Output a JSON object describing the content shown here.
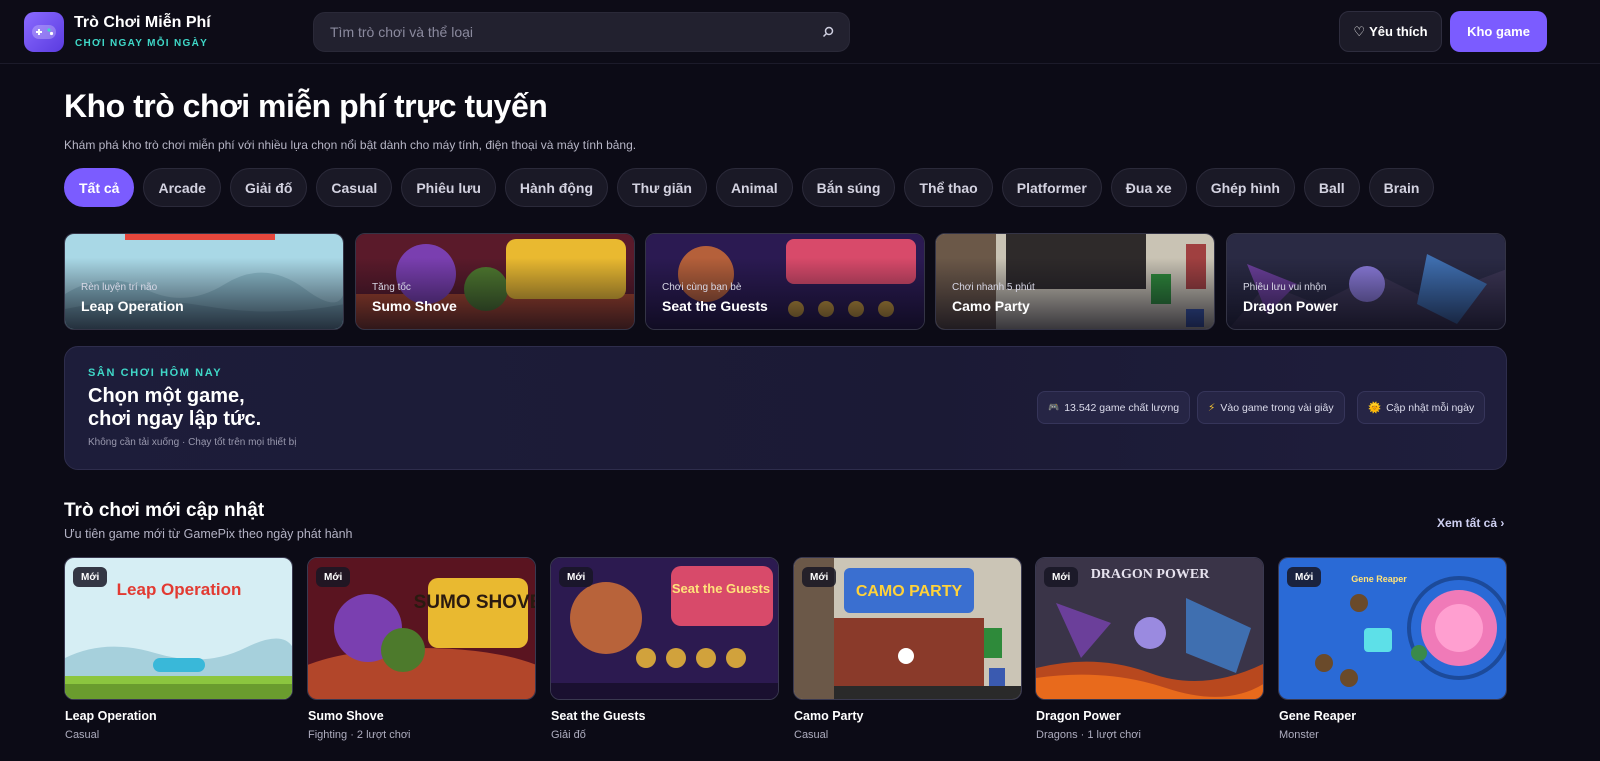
{
  "header": {
    "logo_title": "Trò Chơi Miễn Phí",
    "logo_subtitle": "CHƠI NGAY MỖI NGÀY",
    "search_placeholder": "Tìm trò chơi và thể loại",
    "favorites_label": "Yêu thích",
    "library_label": "Kho game"
  },
  "hero": {
    "title": "Kho trò chơi miễn phí trực tuyến",
    "description": "Khám phá kho trò chơi miễn phí với nhiều lựa chọn nổi bật dành cho máy tính, điện thoại và máy tính bảng."
  },
  "categories": [
    "Tất cả",
    "Arcade",
    "Giải đố",
    "Casual",
    "Phiêu lưu",
    "Hành động",
    "Thư giãn",
    "Animal",
    "Bắn súng",
    "Thể thao",
    "Platformer",
    "Đua xe",
    "Ghép hình",
    "Ball",
    "Brain"
  ],
  "featured": [
    {
      "tag": "Rèn luyện trí não",
      "name": "Leap Operation"
    },
    {
      "tag": "Tăng tốc",
      "name": "Sumo Shove"
    },
    {
      "tag": "Chơi cùng bạn bè",
      "name": "Seat the Guests"
    },
    {
      "tag": "Chơi nhanh 5 phút",
      "name": "Camo Party"
    },
    {
      "tag": "Phiêu lưu vui nhộn",
      "name": "Dragon Power"
    }
  ],
  "today": {
    "eyebrow": "SÂN CHƠI HÔM NAY",
    "headline_1": "Chọn một game,",
    "headline_2": "chơi ngay lập tức.",
    "note": "Không cần tải xuống · Chạy tốt trên mọi thiết bị",
    "stats": [
      {
        "icon": "🎮",
        "text": "13.542 game chất lượng"
      },
      {
        "icon": "⚡",
        "text": "Vào game trong vài giây"
      },
      {
        "icon": "🌞",
        "text": "Cập nhật mỗi ngày"
      }
    ]
  },
  "new_games": {
    "title": "Trò chơi mới cập nhật",
    "subtitle": "Ưu tiên game mới từ GamePix theo ngày phát hành",
    "see_all": "Xem tất cả",
    "badge": "Mới",
    "items": [
      {
        "name": "Leap Operation",
        "meta": "Casual",
        "art_text": "Leap Operation"
      },
      {
        "name": "Sumo Shove",
        "meta": "Fighting · 2 lượt chơi",
        "art_text": "SUMO SHOVE"
      },
      {
        "name": "Seat the Guests",
        "meta": "Giải đố",
        "art_text": "Seat the Guests"
      },
      {
        "name": "Camo Party",
        "meta": "Casual",
        "art_text": "CAMO PARTY"
      },
      {
        "name": "Dragon Power",
        "meta": "Dragons · 1 lượt chơi",
        "art_text": "DRAGON POWER"
      },
      {
        "name": "Gene Reaper",
        "meta": "Monster",
        "art_text": "Gene Reaper"
      }
    ]
  },
  "colors": {
    "accent": "#7b5cff",
    "teal": "#3fd8c8",
    "background": "#0c0b16"
  }
}
